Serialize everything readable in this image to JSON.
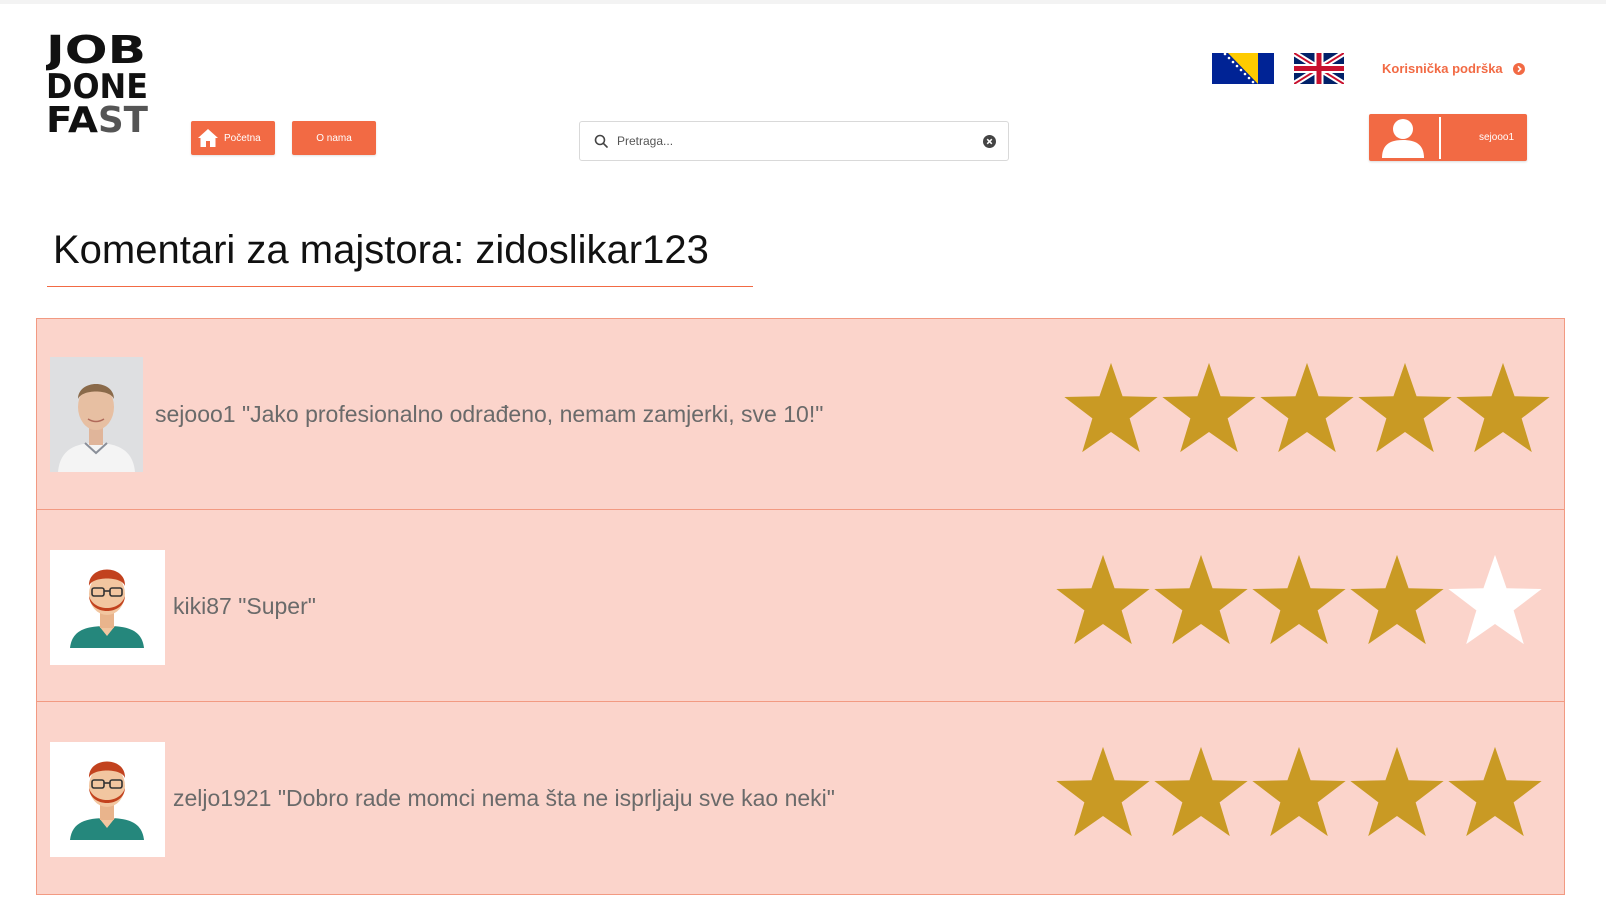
{
  "logo": {
    "line1": "JOB",
    "line2": "DONE",
    "line3a": "FA",
    "line3b": "ST"
  },
  "nav": {
    "home_label": "Početna",
    "about_label": "O nama"
  },
  "search": {
    "placeholder": "Pretraga...",
    "value": ""
  },
  "header": {
    "support_label": "Korisnička podrška",
    "user_label": "sejooo1"
  },
  "flags": [
    "bosnia-and-herzegovina-flag",
    "united-kingdom-flag"
  ],
  "page": {
    "title": "Komentari za majstora: zidoslikar123"
  },
  "colors": {
    "accent": "#f26a44",
    "star_filled": "#c99a24",
    "star_empty": "#ffffff",
    "comment_bg": "#fbd4cb"
  },
  "comments": [
    {
      "user": "sejooo1",
      "text": "\"Jako profesionalno odrađeno, nemam zamjerki, sve 10!\"",
      "rating": 5,
      "max_rating": 5,
      "avatar": "user-photo"
    },
    {
      "user": "kiki87",
      "text": "\"Super\"",
      "rating": 4,
      "max_rating": 5,
      "avatar": "bearded-man-avatar-icon"
    },
    {
      "user": "zeljo1921",
      "text": "\"Dobro rade momci nema šta ne isprljaju sve kao neki\"",
      "rating": 5,
      "max_rating": 5,
      "avatar": "bearded-man-avatar-icon"
    }
  ]
}
